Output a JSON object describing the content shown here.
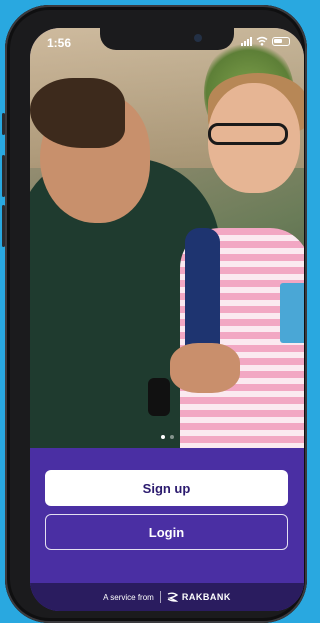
{
  "status_bar": {
    "time": "1:56"
  },
  "onboarding": {
    "carousel": {
      "total_pages": 2,
      "active_page": 1
    }
  },
  "actions": {
    "signup_label": "Sign up",
    "login_label": "Login"
  },
  "footer": {
    "service_text": "A service from",
    "brand_name": "RAKBANK"
  },
  "colors": {
    "background": "#29a8e0",
    "panel": "#4a2fa3",
    "footer": "#2a1c5f",
    "signup_text": "#2b1a6e"
  },
  "icons": {
    "signal": "signal-bars-icon",
    "wifi": "wifi-icon",
    "battery": "battery-icon",
    "brand_logo": "rakbank-logo-icon"
  }
}
